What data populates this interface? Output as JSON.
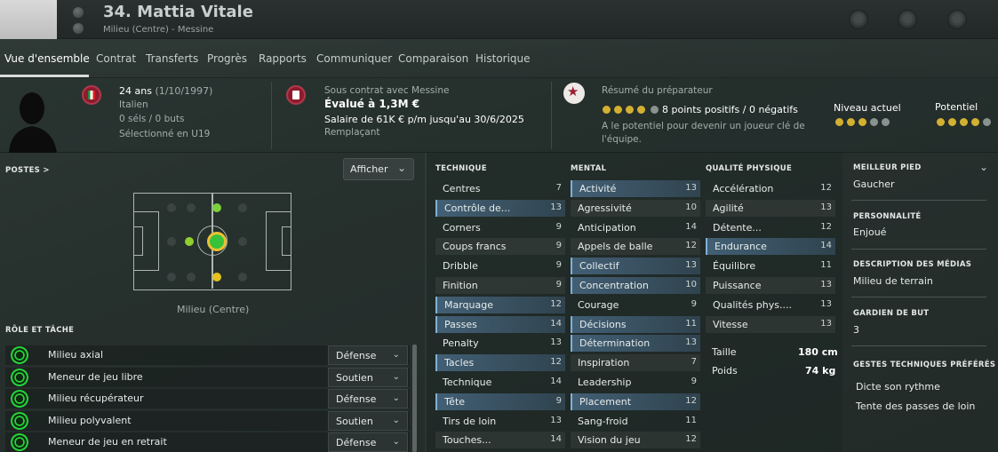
{
  "header": {
    "name": "34. Mattia Vitale",
    "subtitle": "Milieu (Centre) - Messine"
  },
  "tabs": [
    "Vue d'ensemble",
    "Contrat",
    "Transferts",
    "Progrès",
    "Rapports",
    "Communiquer",
    "Comparaison",
    "Historique"
  ],
  "info": {
    "age": "24 ans",
    "birth": "(1/10/1997)",
    "nationality": "Italien",
    "caps": "0 séls / 0 buts",
    "selection": "Sélectionné en U19",
    "contract_with": "Sous contrat avec Messine",
    "value": "Évalué à 1,3M €",
    "salary": "Salaire de 61K € p/m jusqu'au 30/6/2025",
    "status": "Remplaçant",
    "coach_title": "Résumé du préparateur",
    "coach_points": "8 points positifs / 0 négatifs",
    "coach_note_1": "A le potentiel pour devenir un joueur clé de",
    "coach_note_2": "l'équipe.",
    "coach_stars": 4,
    "current_label": "Niveau actuel",
    "current_stars": 3,
    "potential_label": "Potentiel",
    "potential_stars": 4
  },
  "positions": {
    "title": "POSTES >",
    "button": "Afficher",
    "caption": "Milieu (Centre)"
  },
  "roles": {
    "title": "RÔLE ET TÂCHE",
    "items": [
      {
        "role": "Milieu axial",
        "duty": "Défense"
      },
      {
        "role": "Meneur de jeu libre",
        "duty": "Soutien"
      },
      {
        "role": "Milieu récupérateur",
        "duty": "Défense"
      },
      {
        "role": "Milieu polyvalent",
        "duty": "Soutien"
      },
      {
        "role": "Meneur de jeu en retrait",
        "duty": "Défense"
      }
    ]
  },
  "attributes": {
    "technique_title": "TECHNIQUE",
    "mental_title": "MENTAL",
    "physical_title": "QUALITÉ PHYSIQUE",
    "technique": [
      {
        "name": "Centres",
        "value": "7"
      },
      {
        "name": "Contrôle de...",
        "value": "13"
      },
      {
        "name": "Corners",
        "value": "9"
      },
      {
        "name": "Coups francs",
        "value": "9"
      },
      {
        "name": "Dribble",
        "value": "9"
      },
      {
        "name": "Finition",
        "value": "9"
      },
      {
        "name": "Marquage",
        "value": "12"
      },
      {
        "name": "Passes",
        "value": "14"
      },
      {
        "name": "Penalty",
        "value": "13"
      },
      {
        "name": "Tacles",
        "value": "12"
      },
      {
        "name": "Technique",
        "value": "14"
      },
      {
        "name": "Tête",
        "value": "9"
      },
      {
        "name": "Tirs de loin",
        "value": "13"
      },
      {
        "name": "Touches...",
        "value": "14"
      }
    ],
    "mental": [
      {
        "name": "Activité",
        "value": "13"
      },
      {
        "name": "Agressivité",
        "value": "10"
      },
      {
        "name": "Anticipation",
        "value": "14"
      },
      {
        "name": "Appels de balle",
        "value": "12"
      },
      {
        "name": "Collectif",
        "value": "13"
      },
      {
        "name": "Concentration",
        "value": "10"
      },
      {
        "name": "Courage",
        "value": "9"
      },
      {
        "name": "Décisions",
        "value": "11"
      },
      {
        "name": "Détermination",
        "value": "13"
      },
      {
        "name": "Inspiration",
        "value": "7"
      },
      {
        "name": "Leadership",
        "value": "9"
      },
      {
        "name": "Placement",
        "value": "12"
      },
      {
        "name": "Sang-froid",
        "value": "11"
      },
      {
        "name": "Vision du jeu",
        "value": "12"
      }
    ],
    "physical": [
      {
        "name": "Accélération",
        "value": "12"
      },
      {
        "name": "Agilité",
        "value": "13"
      },
      {
        "name": "Détente...",
        "value": "12"
      },
      {
        "name": "Endurance",
        "value": "14"
      },
      {
        "name": "Équilibre",
        "value": "11"
      },
      {
        "name": "Puissance",
        "value": "13"
      },
      {
        "name": "Qualités phys....",
        "value": "13"
      },
      {
        "name": "Vitesse",
        "value": "13"
      }
    ],
    "height_label": "Taille",
    "height": "180 cm",
    "weight_label": "Poids",
    "weight": "74 kg"
  },
  "details": {
    "foot_title": "MEILLEUR PIED",
    "foot": "Gaucher",
    "personality_title": "PERSONNALITÉ",
    "personality": "Enjoué",
    "media_title": "DESCRIPTION DES MÉDIAS",
    "media": "Milieu de terrain",
    "goalkeeper_title": "GARDIEN DE BUT",
    "goalkeeper": "3",
    "traits_title": "GESTES TECHNIQUES PRÉFÉRÉS",
    "traits": [
      "Dicte son rythme",
      "Tente des passes de loin"
    ]
  },
  "colors": {
    "accent": "#7fb1d6",
    "gold": "#d4b030",
    "green": "#27d43a"
  }
}
